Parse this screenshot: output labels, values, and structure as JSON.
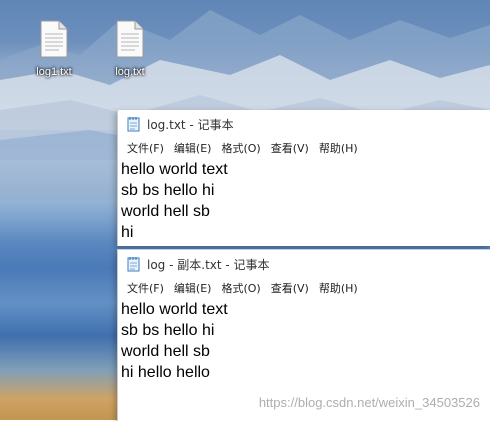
{
  "desktop": {
    "icons": [
      {
        "label": "log1.txt"
      },
      {
        "label": "log.txt"
      }
    ]
  },
  "windows": [
    {
      "title": "log.txt - 记事本",
      "menu": [
        "文件(F)",
        "编辑(E)",
        "格式(O)",
        "查看(V)",
        "帮助(H)"
      ],
      "lines": [
        "hello world text",
        "sb bs hello hi",
        "world hell sb",
        "hi"
      ]
    },
    {
      "title": "log - 副本.txt - 记事本",
      "menu": [
        "文件(F)",
        "编辑(E)",
        "格式(O)",
        "查看(V)",
        "帮助(H)"
      ],
      "lines": [
        "hello world text",
        "sb bs hello hi",
        "world hell sb",
        "hi hello hello"
      ]
    }
  ],
  "watermark": "https://blog.csdn.net/weixin_34503526"
}
